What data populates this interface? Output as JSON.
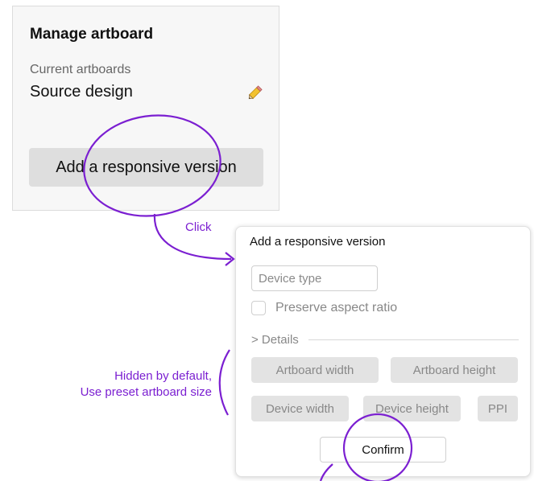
{
  "manage_panel": {
    "title": "Manage artboard",
    "current_label": "Current artboards",
    "current_value": "Source design",
    "add_button_label": "Add a responsive version"
  },
  "dialog": {
    "title": "Add a responsive version",
    "device_type_placeholder": "Device type",
    "preserve_aspect_ratio_label": "Preserve aspect ratio",
    "details_label": "> Details",
    "fields": {
      "artboard_width": "Artboard width",
      "artboard_height": "Artboard height",
      "device_width": "Device width",
      "device_height": "Device height",
      "ppi": "PPI"
    },
    "confirm_label": "Confirm"
  },
  "annotations": {
    "click": "Click",
    "hidden_line1": "Hidden by default,",
    "hidden_line2": "Use preset artboard size",
    "color": "#7b1fd1"
  },
  "icons": {
    "edit": "pencil-icon"
  }
}
